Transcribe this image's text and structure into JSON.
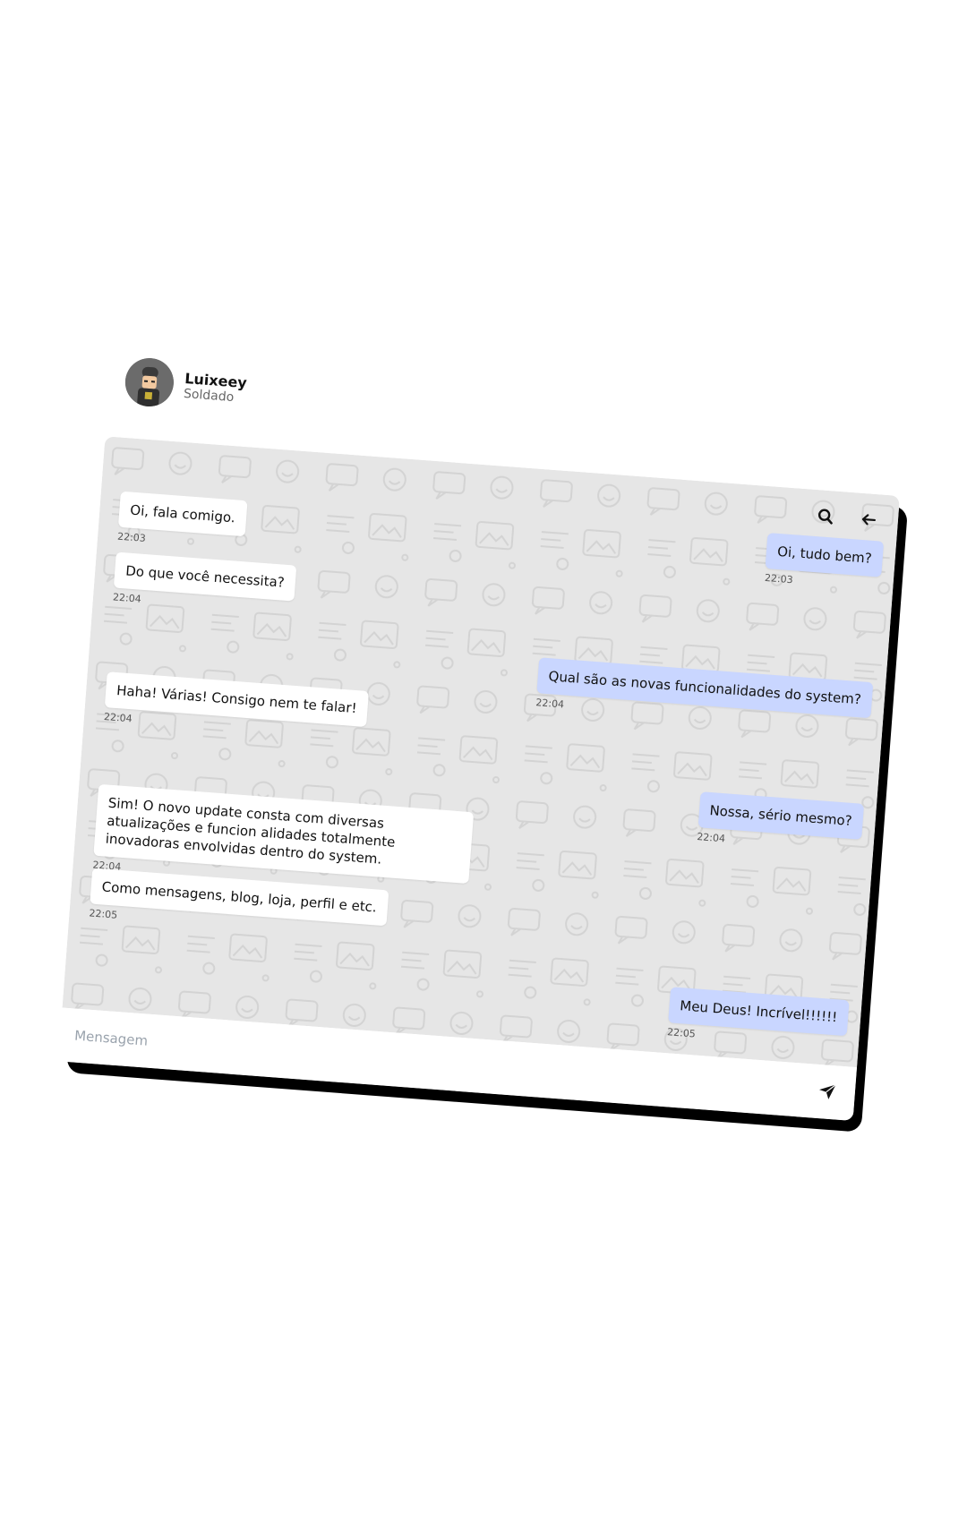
{
  "contact": {
    "name": "Luixeey",
    "status": "Soldado"
  },
  "toolbar": {
    "search_icon": "search-icon",
    "back_icon": "arrow-left-icon"
  },
  "messages": [
    {
      "side": "out",
      "text": "Oi, tudo bem?",
      "time": "22:03"
    },
    {
      "side": "in",
      "text": "Oi, fala comigo.",
      "time": "22:03"
    },
    {
      "side": "in",
      "text": "Do que você necessita?",
      "time": "22:04"
    },
    {
      "side": "out",
      "text": "Qual são as novas funcionalidades do system?",
      "time": "22:04"
    },
    {
      "side": "in",
      "text": "Haha! Várias! Consigo nem te falar!",
      "time": "22:04"
    },
    {
      "side": "out",
      "text": "Nossa, sério mesmo?",
      "time": "22:04"
    },
    {
      "side": "in",
      "text": "Sim! O novo update consta com diversas atualizações e funcion alidades totalmente inovadoras envolvidas dentro do system.",
      "time": "22:04"
    },
    {
      "side": "in",
      "text": "Como mensagens, blog, loja, perfil e etc.",
      "time": "22:05"
    },
    {
      "side": "out",
      "text": "Meu Deus! Incrível!!!!!!",
      "time": "22:05"
    }
  ],
  "composer": {
    "placeholder": "Mensagem",
    "value": "",
    "send_icon": "send-icon"
  },
  "colors": {
    "chat_background": "#e6e6e6",
    "incoming_bubble": "#ffffff",
    "outgoing_bubble": "#c9d6ff",
    "frame_shadow": "#000000"
  }
}
